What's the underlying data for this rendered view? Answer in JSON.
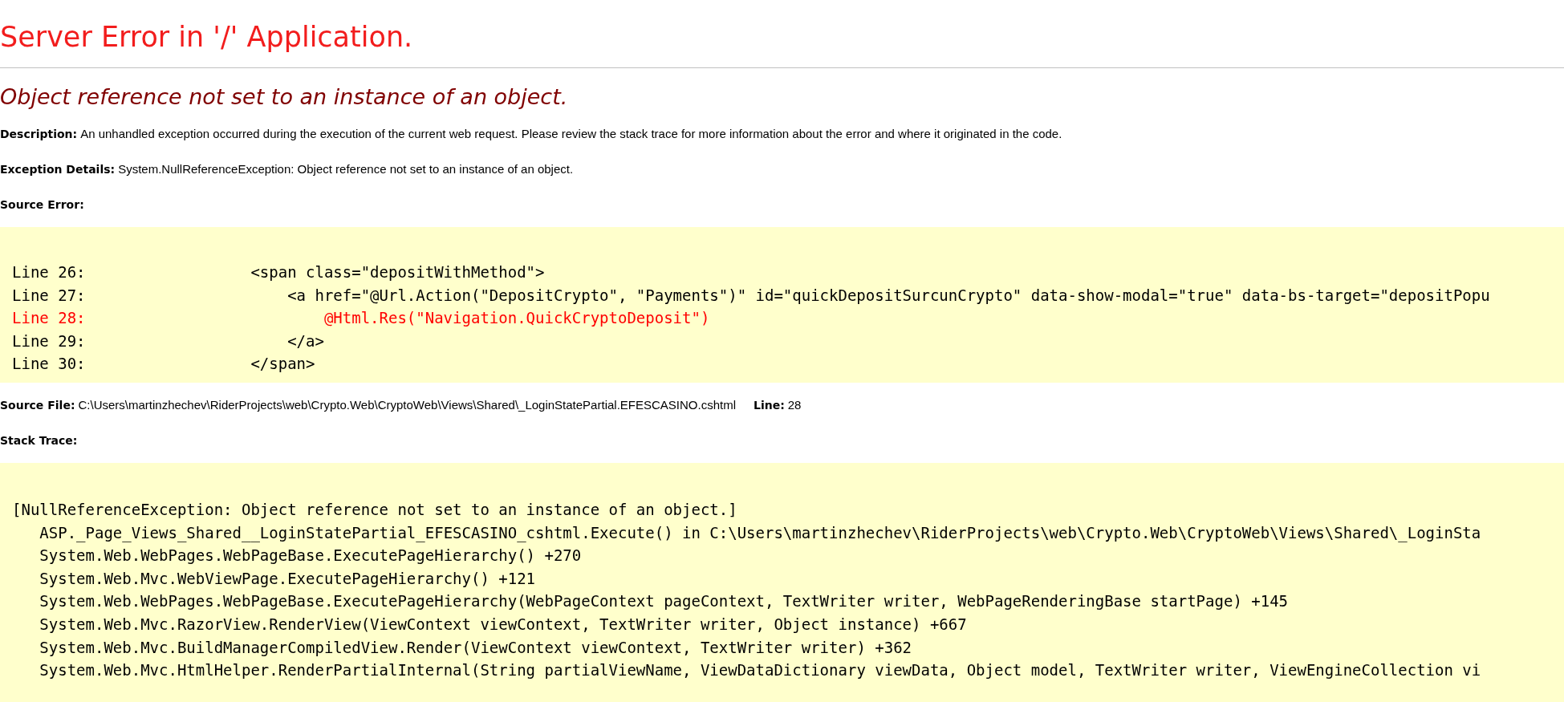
{
  "title": "Server Error in '/' Application.",
  "subtitle": "Object reference not set to an instance of an object.",
  "fields": [
    {
      "label": "Description:",
      "text": "An unhandled exception occurred during the execution of the current web request. Please review the stack trace for more information about the error and where it originated in the code."
    },
    {
      "label": "Exception Details:",
      "text": "System.NullReferenceException: Object reference not set to an instance of an object."
    }
  ],
  "source_error": {
    "label": "Source Error:",
    "lines": [
      {
        "number": "Line 26:",
        "code": "                  <span class=\"depositWithMethod\">",
        "highlighted": false
      },
      {
        "number": "Line 27:",
        "code": "                      <a href=\"@Url.Action(\"DepositCrypto\", \"Payments\")\" id=\"quickDepositSurcunCrypto\" data-show-modal=\"true\" data-bs-target=\"depositPopu",
        "highlighted": false
      },
      {
        "number": "Line 28:",
        "code": "                          @Html.Res(\"Navigation.QuickCryptoDeposit\")",
        "highlighted": true
      },
      {
        "number": "Line 29:",
        "code": "                      </a>",
        "highlighted": false
      },
      {
        "number": "Line 30:",
        "code": "                  </span>",
        "highlighted": false
      }
    ]
  },
  "source_file": {
    "label": "Source File:",
    "path": "C:\\Users\\martinzhechev\\RiderProjects\\web\\Crypto.Web\\CryptoWeb\\Views\\Shared\\_LoginStatePartial.EFESCASINO.cshtml",
    "line_label": "Line:",
    "line": "28"
  },
  "stack_trace": {
    "label": "Stack Trace:",
    "lines": [
      {
        "kind": "exception",
        "text": "[NullReferenceException: Object reference not set to an instance of an object.]"
      },
      {
        "kind": "frame",
        "text": "ASP._Page_Views_Shared__LoginStatePartial_EFESCASINO_cshtml.Execute() in C:\\Users\\martinzhechev\\RiderProjects\\web\\Crypto.Web\\CryptoWeb\\Views\\Shared\\_LoginSta"
      },
      {
        "kind": "frame",
        "text": "System.Web.WebPages.WebPageBase.ExecutePageHierarchy() +270"
      },
      {
        "kind": "frame",
        "text": "System.Web.Mvc.WebViewPage.ExecutePageHierarchy() +121"
      },
      {
        "kind": "frame",
        "text": "System.Web.WebPages.WebPageBase.ExecutePageHierarchy(WebPageContext pageContext, TextWriter writer, WebPageRenderingBase startPage) +145"
      },
      {
        "kind": "frame",
        "text": "System.Web.Mvc.RazorView.RenderView(ViewContext viewContext, TextWriter writer, Object instance) +667"
      },
      {
        "kind": "frame",
        "text": "System.Web.Mvc.BuildManagerCompiledView.Render(ViewContext viewContext, TextWriter writer) +362"
      },
      {
        "kind": "frame",
        "text": "System.Web.Mvc.HtmlHelper.RenderPartialInternal(String partialViewName, ViewDataDictionary viewData, Object model, TextWriter writer, ViewEngineCollection vi"
      }
    ]
  }
}
